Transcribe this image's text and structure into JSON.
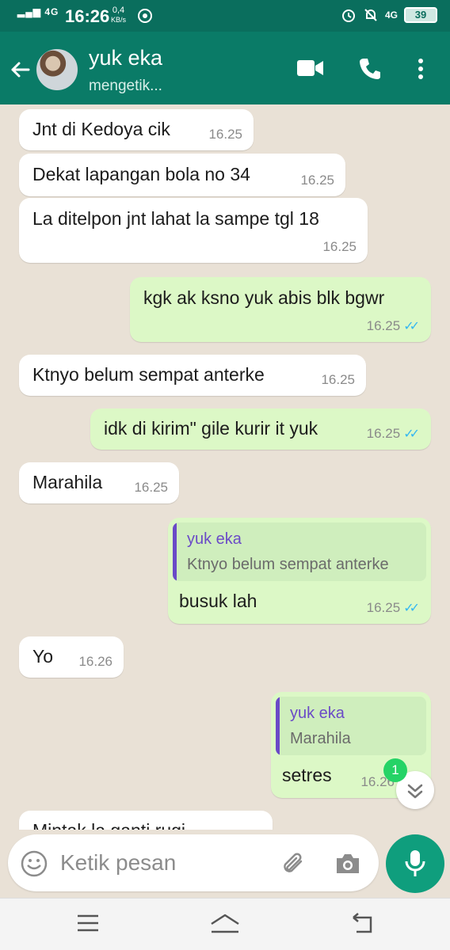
{
  "status_bar": {
    "time": "16:26",
    "network_left": "4G",
    "speed_value": "0,4",
    "speed_unit": "KB/s",
    "network_right": "4G",
    "battery": "39"
  },
  "header": {
    "contact_name": "yuk eka",
    "contact_status": "mengetik..."
  },
  "messages": [
    {
      "type": "in",
      "text": "Jnt di Kedoya cik",
      "time": "16.25"
    },
    {
      "type": "in",
      "text": "Dekat lapangan bola no 34",
      "time": "16.25"
    },
    {
      "type": "in",
      "text": "La ditelpon jnt lahat la sampe tgl 18",
      "time": "16.25"
    },
    {
      "type": "out",
      "text": "kgk ak ksno yuk abis blk bgwr",
      "time": "16.25"
    },
    {
      "type": "in",
      "text": "Ktnyo belum sempat anterke",
      "time": "16.25"
    },
    {
      "type": "out",
      "text": "idk di kirim\" gile kurir it yuk",
      "time": "16.25"
    },
    {
      "type": "in",
      "text": "Marahila",
      "time": "16.25"
    },
    {
      "type": "out",
      "text": "busuk lah",
      "time": "16.25",
      "quote_name": "yuk eka",
      "quote_text": "Ktnyo belum sempat anterke"
    },
    {
      "type": "in",
      "text": "Yo",
      "time": "16.26"
    },
    {
      "type": "out",
      "text": "setres",
      "time": "16.26",
      "quote_name": "yuk eka",
      "quote_text": "Marahila"
    },
    {
      "type": "in",
      "text": "Mintak la ganti rugi",
      "time": ""
    }
  ],
  "unread_count": "1",
  "composer": {
    "placeholder": "Ketik pesan"
  },
  "colors": {
    "header": "#0a7b67",
    "incoming_bubble": "#ffffff",
    "outgoing_bubble": "#dcf8c6",
    "read_ticks": "#34b7f1",
    "mic_button": "#0f9e7d"
  }
}
